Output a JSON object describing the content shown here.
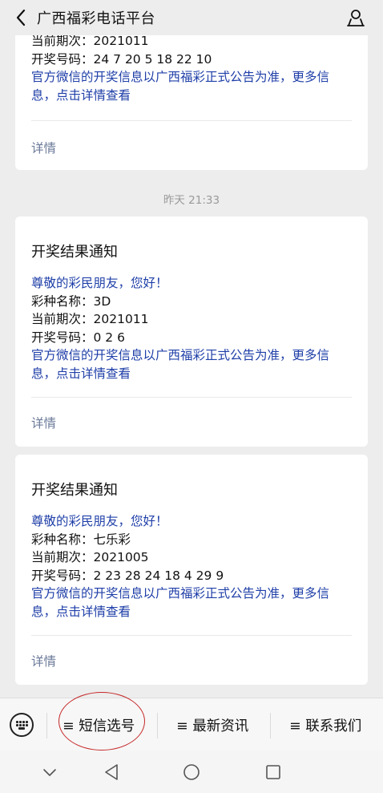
{
  "header": {
    "title": "广西福彩电话平台"
  },
  "cards": [
    {
      "title": "",
      "greeting": "",
      "lottery": "",
      "period": "当前期次：2021011",
      "numbers": "开奖号码：24 7 20 5 18 22 10",
      "notice_line1": "官方微信的开奖信息以广西福彩正式公告为准，更多信",
      "notice_line2": "息，点击详情查看",
      "detail": "详情"
    },
    {
      "title": "开奖结果通知",
      "greeting": "尊敬的彩民朋友，您好！",
      "lottery": "彩种名称：3D",
      "period": "当前期次：2021011",
      "numbers": "开奖号码：0 2 6",
      "notice_line1": "官方微信的开奖信息以广西福彩正式公告为准，更多信",
      "notice_line2": "息，点击详情查看",
      "detail": "详情"
    },
    {
      "title": "开奖结果通知",
      "greeting": "尊敬的彩民朋友，您好！",
      "lottery": "彩种名称：七乐彩",
      "period": "当前期次：2021005",
      "numbers": "开奖号码：2 23 28 24 18 4 29 9",
      "notice_line1": "官方微信的开奖信息以广西福彩正式公告为准，更多信",
      "notice_line2": "息，点击详情查看",
      "detail": "详情"
    }
  ],
  "timestamp": "昨天 21:33",
  "menu": {
    "items": [
      "≡ 短信选号",
      "≡ 最新资讯",
      "≡ 联系我们"
    ]
  },
  "colors": {
    "link_blue": "#1f3fa8",
    "detail_gray": "#6b7a99",
    "annotation_red": "#c62828"
  }
}
